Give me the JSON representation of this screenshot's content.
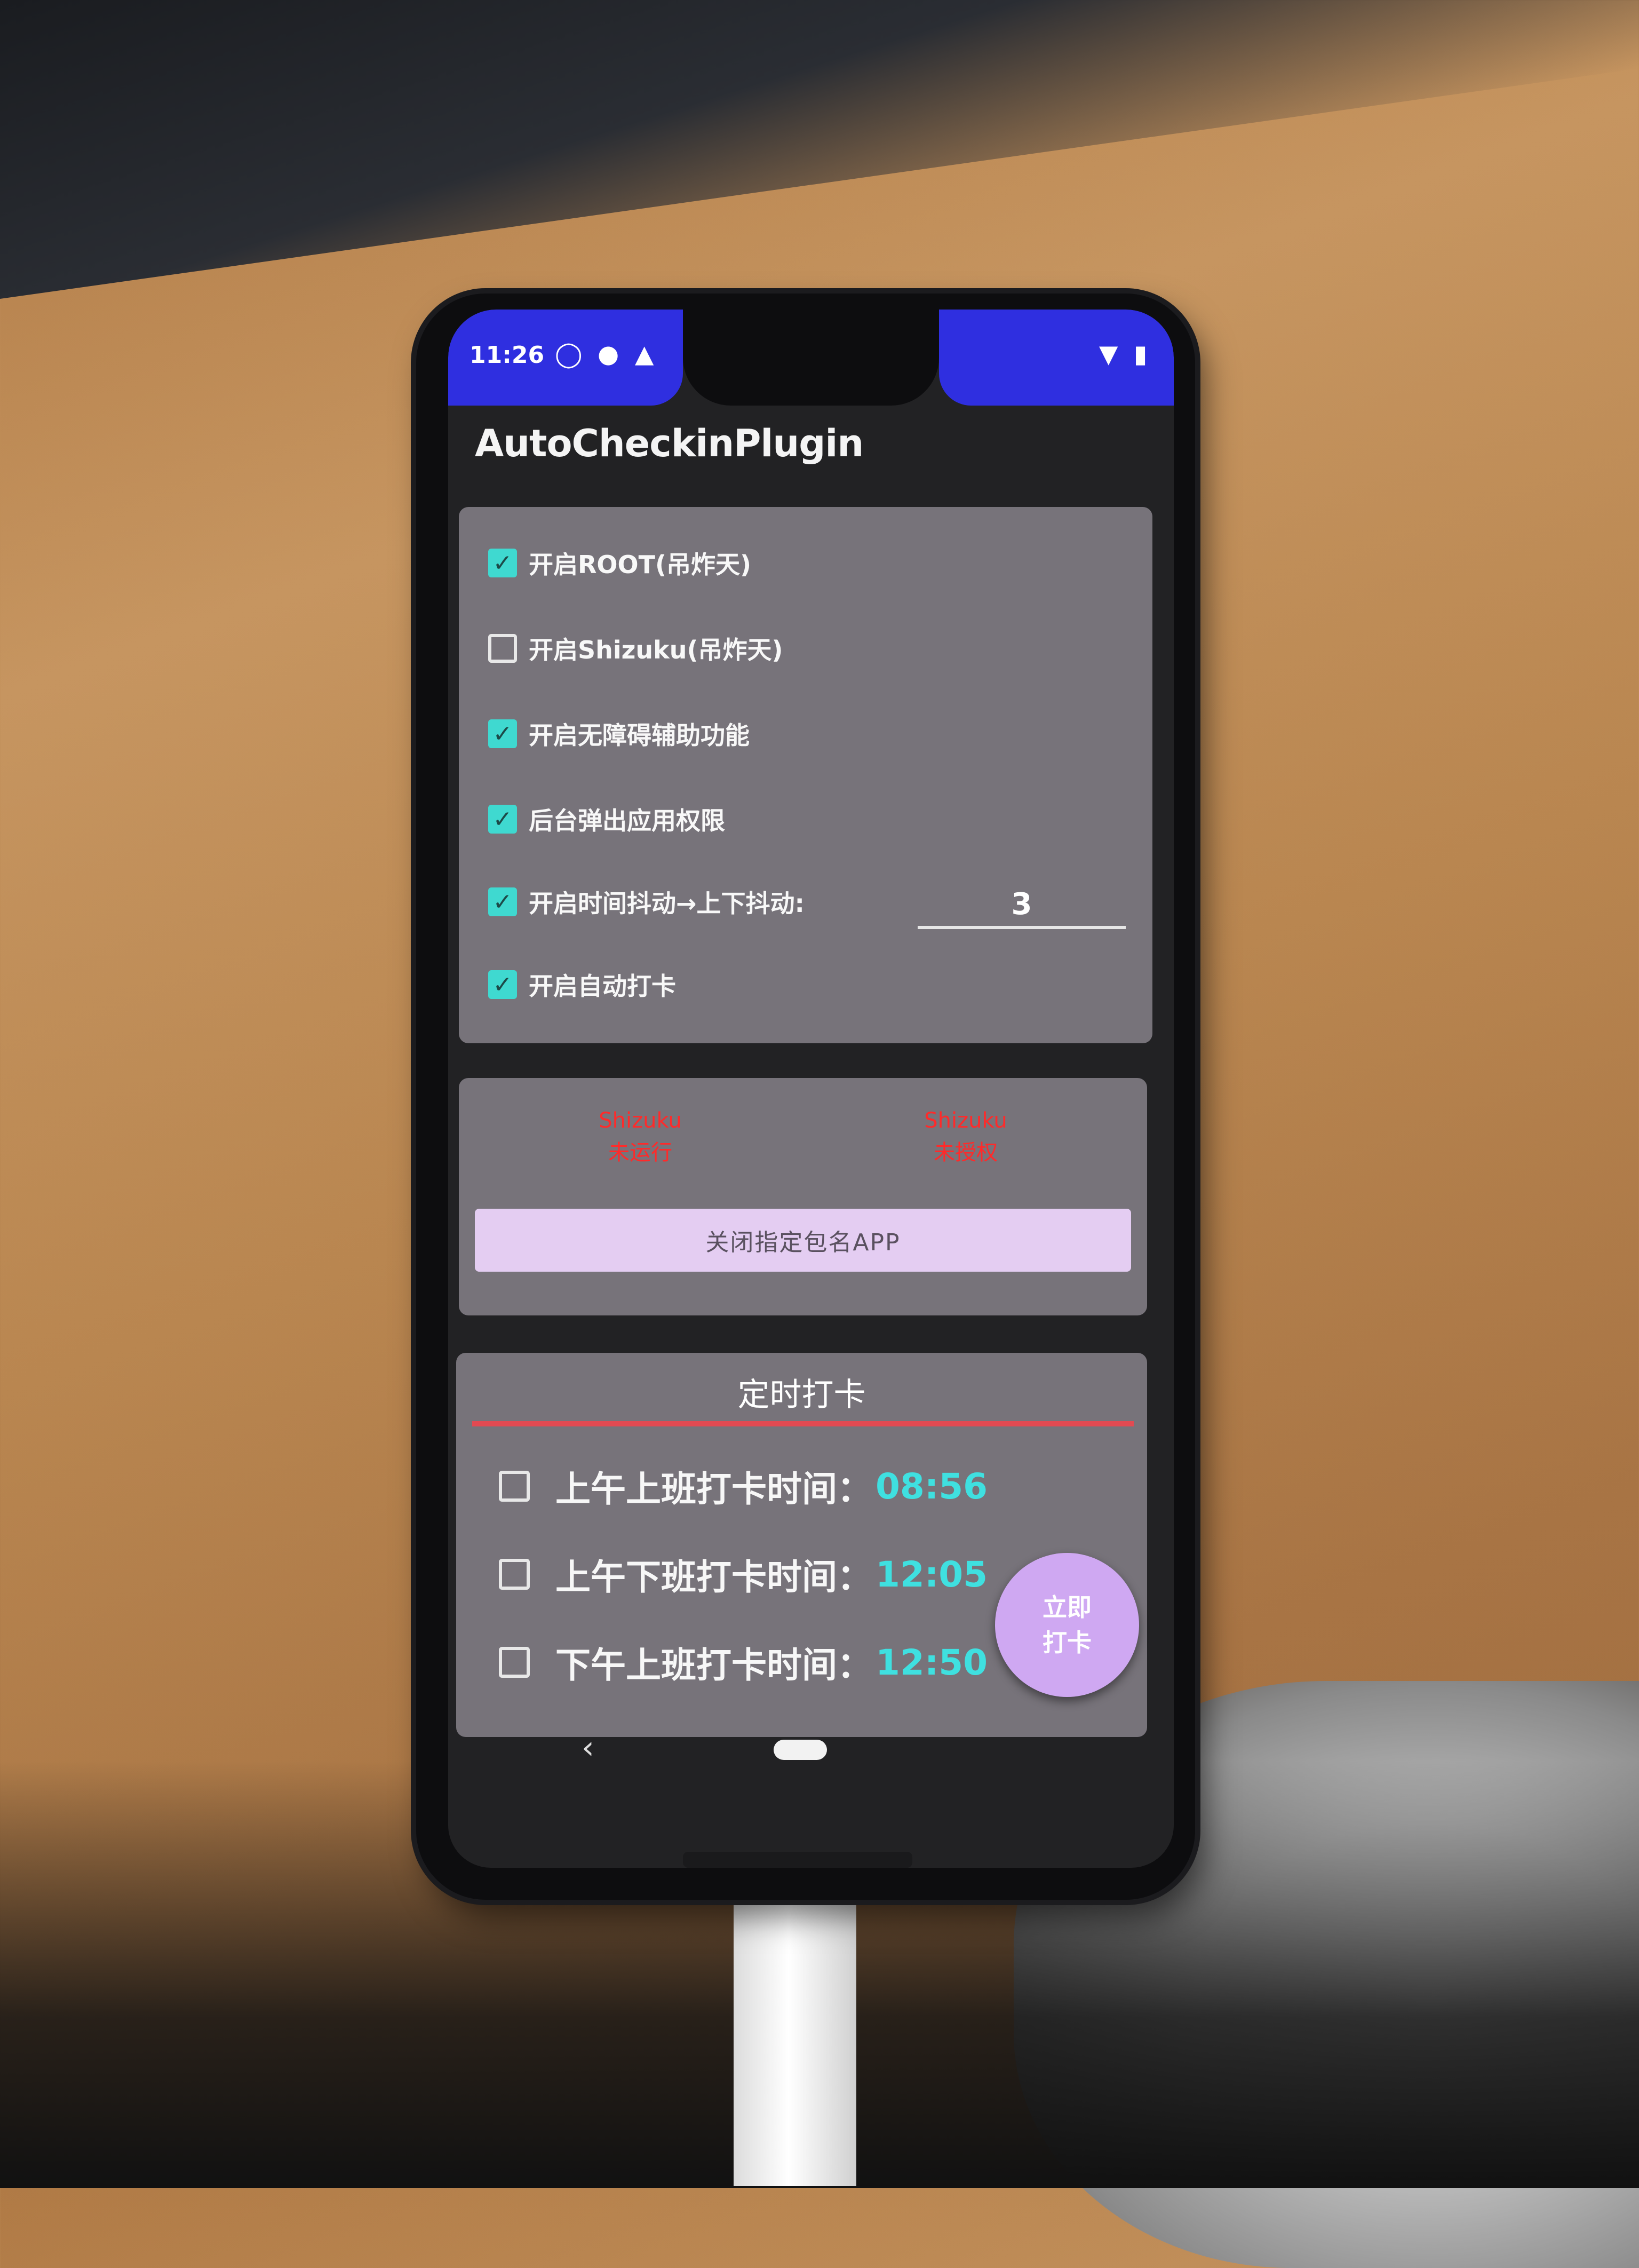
{
  "status_bar": {
    "time": "11:26",
    "left_icons": [
      "android-debug-icon",
      "circle-icon",
      "warning-icon"
    ],
    "right_icons": [
      "wifi-icon",
      "battery-icon"
    ],
    "color": "#2f2fe0"
  },
  "app": {
    "title": "AutoCheckinPlugin"
  },
  "settings": {
    "items": [
      {
        "label": "开启ROOT(吊炸天)",
        "checked": true
      },
      {
        "label": "开启Shizuku(吊炸天)",
        "checked": false
      },
      {
        "label": "开启无障碍辅助功能",
        "checked": true
      },
      {
        "label": "后台弹出应用权限",
        "checked": true
      },
      {
        "label": "开启时间抖动→上下抖动:",
        "checked": true
      },
      {
        "label": "开启自动打卡",
        "checked": true
      }
    ],
    "jitter_value": "3"
  },
  "shizuku": {
    "status_left_line1": "Shizuku",
    "status_left_line2": "未运行",
    "status_right_line1": "Shizuku",
    "status_right_line2": "未授权",
    "close_app_button": "关闭指定包名APP"
  },
  "schedule": {
    "title": "定时打卡",
    "rows": [
      {
        "label": "上午上班打卡时间：",
        "time": "08:56",
        "checked": false
      },
      {
        "label": "上午下班打卡时间：",
        "time": "12:05",
        "checked": false
      },
      {
        "label": "下午上班打卡时间：",
        "time": "12:50",
        "checked": false
      }
    ],
    "fab_line1": "立即",
    "fab_line2": "打卡"
  },
  "colors": {
    "accent": "#3fd9d0",
    "card": "#77737a",
    "warning_text": "#ff2a2a",
    "divider": "#e24a52",
    "fab": "#cfa8f2",
    "button": "#e4cdf2"
  }
}
